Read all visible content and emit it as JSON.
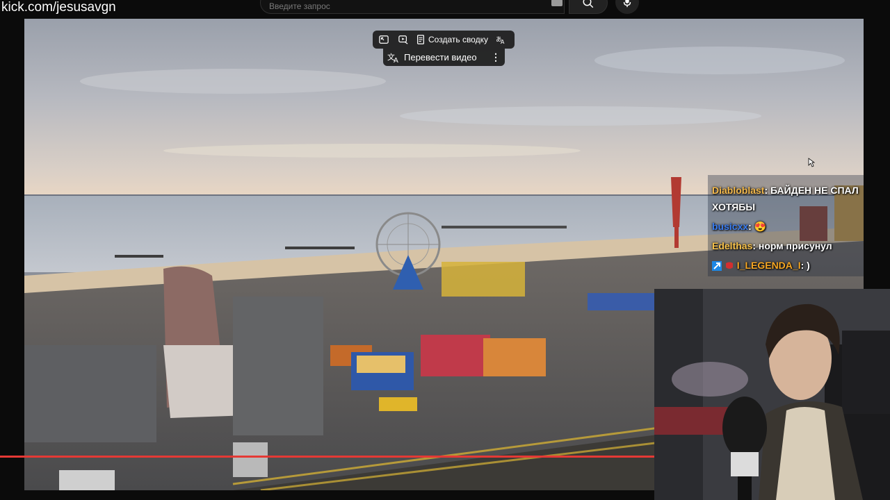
{
  "watermark": "kick.com/jesusavgn",
  "search": {
    "placeholder": "Введите запрос"
  },
  "toolbar": {
    "summary_label": "Создать сводку"
  },
  "translate": {
    "label": "Перевести видео"
  },
  "chat": {
    "messages": [
      {
        "user": "Diabloblast",
        "sep": ": ",
        "text": "БАЙДЕН НЕ СПАЛ"
      },
      {
        "user": "",
        "sep": "",
        "text": "ХОТЯБЫ"
      },
      {
        "user": "busicxx",
        "sep": ": ",
        "text": "😍"
      },
      {
        "user": "Edelthas",
        "sep": ": ",
        "text": "норм присунул"
      },
      {
        "user": "I_LEGENDA_I",
        "sep": ": ",
        "text": ")"
      }
    ]
  },
  "colors": {
    "progress": "#e53935",
    "chat_user_1": "#f2b84b",
    "chat_user_2": "#3a7cf0"
  },
  "icons": [
    "search-icon",
    "mic-icon",
    "keyboard-icon",
    "pip-icon",
    "play-queue-icon",
    "summary-icon",
    "translate-icon",
    "more-icon"
  ]
}
